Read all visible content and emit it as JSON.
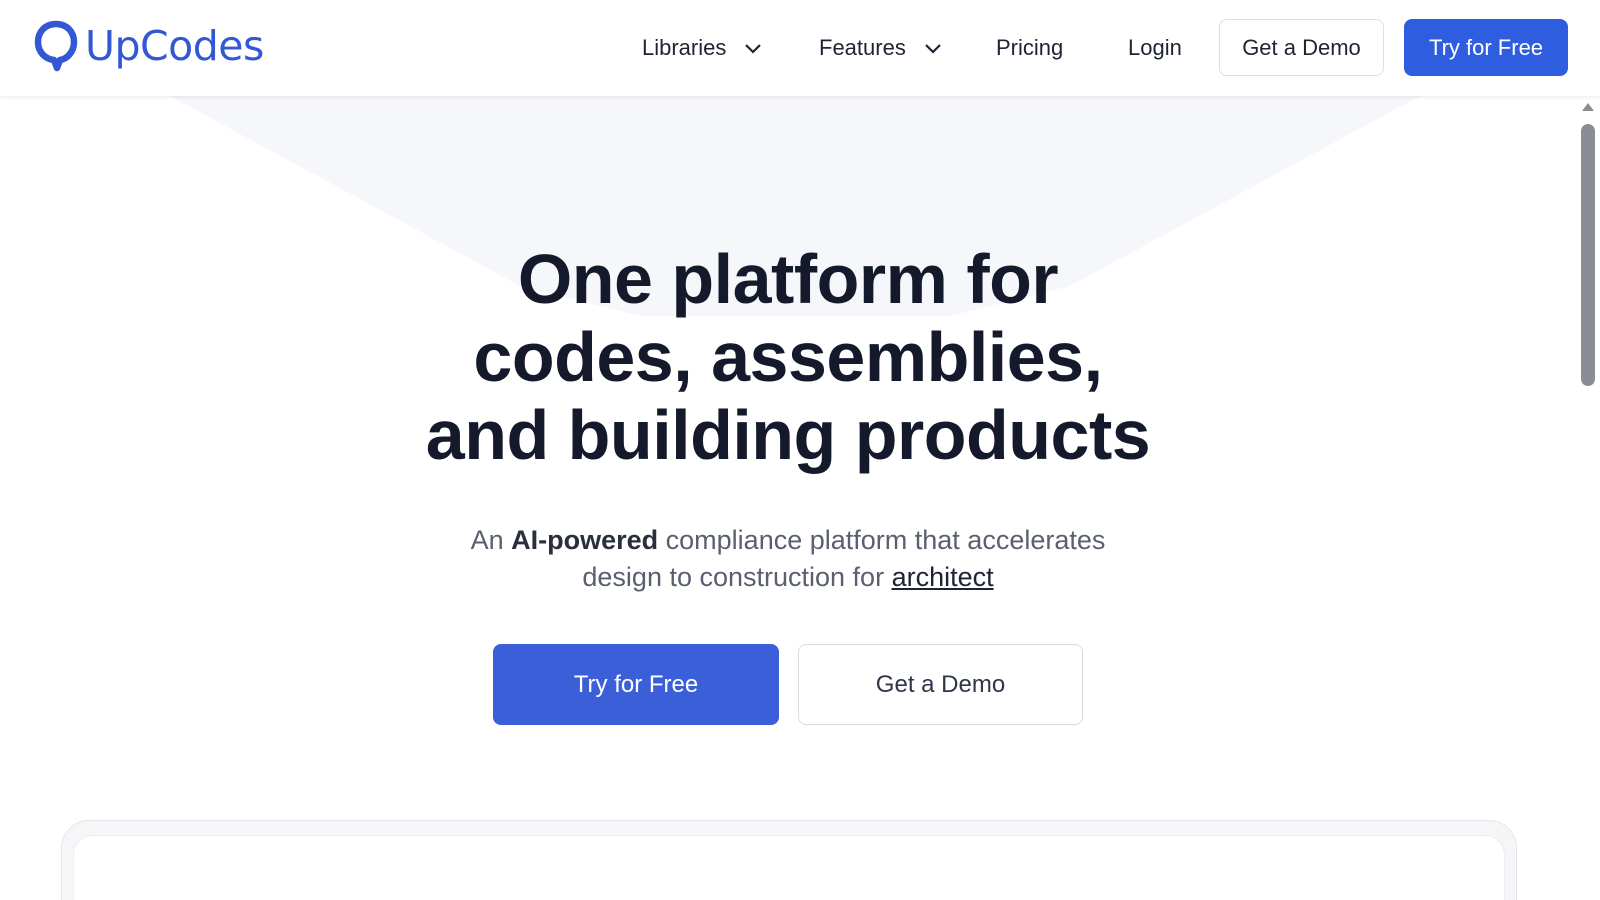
{
  "brand": {
    "name": "UpCodes",
    "color": "#3358d4"
  },
  "nav": {
    "items": [
      {
        "label": "Libraries",
        "has_dropdown": true
      },
      {
        "label": "Features",
        "has_dropdown": true
      },
      {
        "label": "Pricing",
        "has_dropdown": false
      },
      {
        "label": "Login",
        "has_dropdown": false
      }
    ],
    "demo_label": "Get a Demo",
    "free_label": "Try for Free"
  },
  "hero": {
    "title_lines": [
      "One platform for",
      "codes, assemblies,",
      "and building products"
    ],
    "subtitle": {
      "prefix": "An ",
      "bold": "AI-powered",
      "middle": " compliance platform that accelerates",
      "line2": "design to construction for ",
      "link": "architect"
    },
    "primary_cta": "Try for Free",
    "secondary_cta": "Get a Demo"
  },
  "colors": {
    "primary": "#2f5de0",
    "text": "#141a2b",
    "muted": "#5b6070"
  }
}
